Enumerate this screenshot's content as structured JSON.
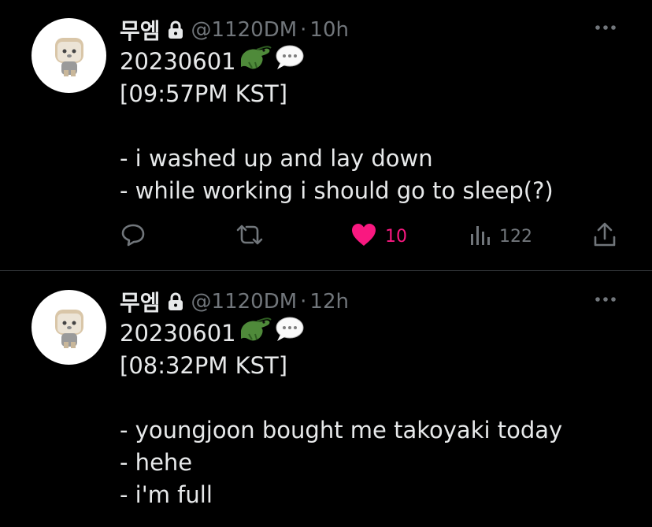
{
  "tweets": [
    {
      "display_name": "무엠",
      "handle": "@1120DM",
      "separator": "·",
      "time": "10h",
      "lines": [
        "20230601",
        "[09:57PM KST]",
        "",
        "- i washed up and lay down",
        "- while working i should go to sleep(?)"
      ],
      "likes": "10",
      "views": "122",
      "liked": true
    },
    {
      "display_name": "무엠",
      "handle": "@1120DM",
      "separator": "·",
      "time": "12h",
      "lines": [
        "20230601",
        "[08:32PM KST]",
        "",
        "- youngjoon bought me takoyaki today",
        "- hehe",
        "- i'm full"
      ]
    }
  ],
  "colors": {
    "background": "#000000",
    "text": "#e7e9ea",
    "muted": "#71767b",
    "like": "#f91880",
    "divider": "#2f3336"
  },
  "icons": [
    "lock-icon",
    "crocodile-emoji",
    "speech-bubble-emoji",
    "reply-icon",
    "retweet-icon",
    "heart-icon",
    "views-icon",
    "share-icon",
    "more-icon"
  ]
}
